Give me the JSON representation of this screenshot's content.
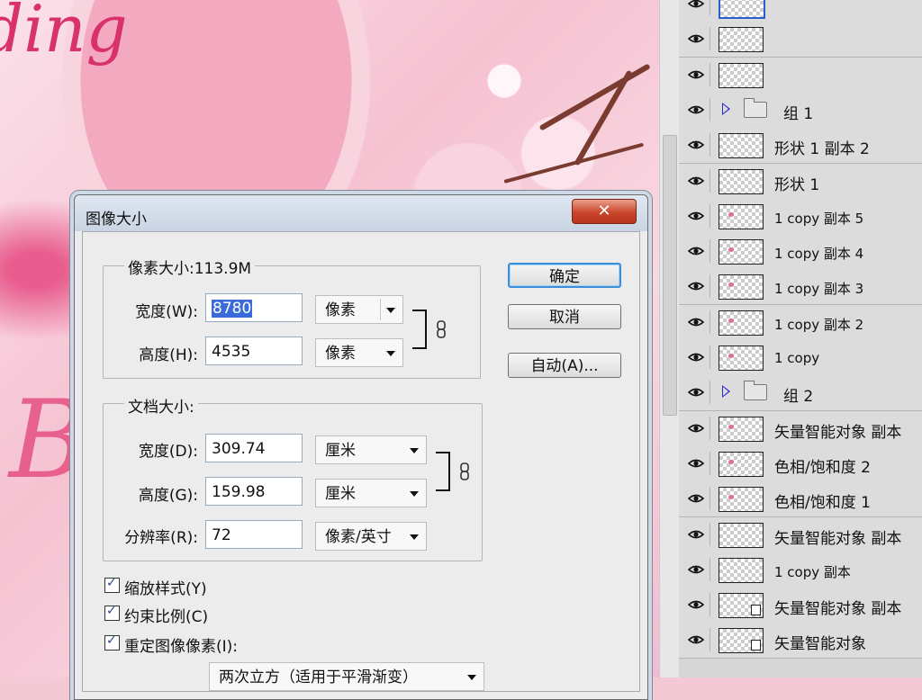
{
  "dialog": {
    "title": "图像大小",
    "close_symbol": "✕",
    "pixel_dimensions": {
      "legend": "像素大小:113.9M",
      "width_label": "宽度(W):",
      "width_value": "8780",
      "width_unit": "像素",
      "height_label": "高度(H):",
      "height_value": "4535",
      "height_unit": "像素"
    },
    "document_size": {
      "legend": "文档大小:",
      "width_label": "宽度(D):",
      "width_value": "309.74",
      "width_unit": "厘米",
      "height_label": "高度(G):",
      "height_value": "159.98",
      "height_unit": "厘米",
      "resolution_label": "分辨率(R):",
      "resolution_value": "72",
      "resolution_unit": "像素/英寸"
    },
    "buttons": {
      "ok": "确定",
      "cancel": "取消",
      "auto": "自动(A)..."
    },
    "checkboxes": {
      "scale_styles": "缩放样式(Y)",
      "constrain_proportions": "约束比例(C)",
      "resample_image": "重定图像像素(I):"
    },
    "resample_method": "两次立方（适用于平滑渐变）"
  },
  "layers": [
    {
      "name": "",
      "type": "layer",
      "thumb": "selected"
    },
    {
      "name": "",
      "type": "layer",
      "thumb": "empty"
    },
    {
      "name": "",
      "type": "layer",
      "thumb": "empty"
    },
    {
      "name": "组 1",
      "type": "group"
    },
    {
      "name": "形状 1 副本 2",
      "type": "layer",
      "thumb": "empty"
    },
    {
      "name": "形状 1",
      "type": "layer",
      "thumb": "empty"
    },
    {
      "name": "1 copy 副本 5",
      "type": "layer",
      "thumb": "pink"
    },
    {
      "name": "1 copy 副本 4",
      "type": "layer",
      "thumb": "pink"
    },
    {
      "name": "1 copy 副本 3",
      "type": "layer",
      "thumb": "pink"
    },
    {
      "name": "1 copy 副本 2",
      "type": "layer",
      "thumb": "pink"
    },
    {
      "name": "1 copy",
      "type": "layer",
      "thumb": "pink"
    },
    {
      "name": "组 2",
      "type": "group"
    },
    {
      "name": "矢量智能对象 副本",
      "type": "layer",
      "thumb": "pink"
    },
    {
      "name": "色相/饱和度 2",
      "type": "layer",
      "thumb": "pink"
    },
    {
      "name": "色相/饱和度 1",
      "type": "layer",
      "thumb": "pink"
    },
    {
      "name": "矢量智能对象 副本",
      "type": "layer",
      "thumb": "empty"
    },
    {
      "name": "1 copy 副本",
      "type": "layer",
      "thumb": "empty"
    },
    {
      "name": "矢量智能对象 副本",
      "type": "layer",
      "thumb": "smart"
    },
    {
      "name": "矢量智能对象",
      "type": "layer",
      "thumb": "smart"
    }
  ],
  "canvas": {
    "script_text_top": "ding",
    "script_text_bottom": "B"
  },
  "colors": {
    "accent_blue": "#3a6bd8",
    "close_red": "#c9452b",
    "pink": "#e85d8e"
  }
}
